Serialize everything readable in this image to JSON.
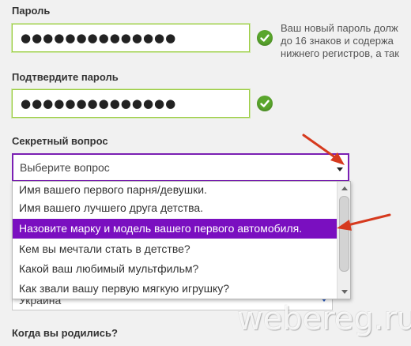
{
  "password": {
    "label": "Пароль",
    "value": "●●●●●●●●●●●●●●",
    "hint_lines": [
      "Ваш новый пароль долж",
      "до 16 знаков и содержа",
      "нижнего регистров, а так"
    ]
  },
  "confirm": {
    "label": "Подтвердите пароль",
    "value": "●●●●●●●●●●●●●●"
  },
  "secret": {
    "label": "Секретный вопрос",
    "selected": "Выберите вопрос",
    "options": [
      "Имя вашего первого парня/девушки.",
      "Имя вашего лучшего друга детства.",
      "Назовите марку и модель вашего первого автомобиля.",
      "Кем вы мечтали стать в детстве?",
      "Какой ваш любимый мультфильм?",
      "Как звали вашу первую мягкую игрушку?"
    ],
    "highlighted_index": 2
  },
  "country": {
    "value": "Украина"
  },
  "birth": {
    "label": "Когда вы родились?"
  },
  "watermark": "webereg.ru",
  "colors": {
    "accent_purple": "#7a0fc0",
    "field_border_green": "#9ccc43",
    "check_green": "#5aa62d",
    "arrow_red": "#d63a1e"
  },
  "icons": {
    "valid": "check-circle-icon",
    "annotation": "red-arrow-icon"
  }
}
